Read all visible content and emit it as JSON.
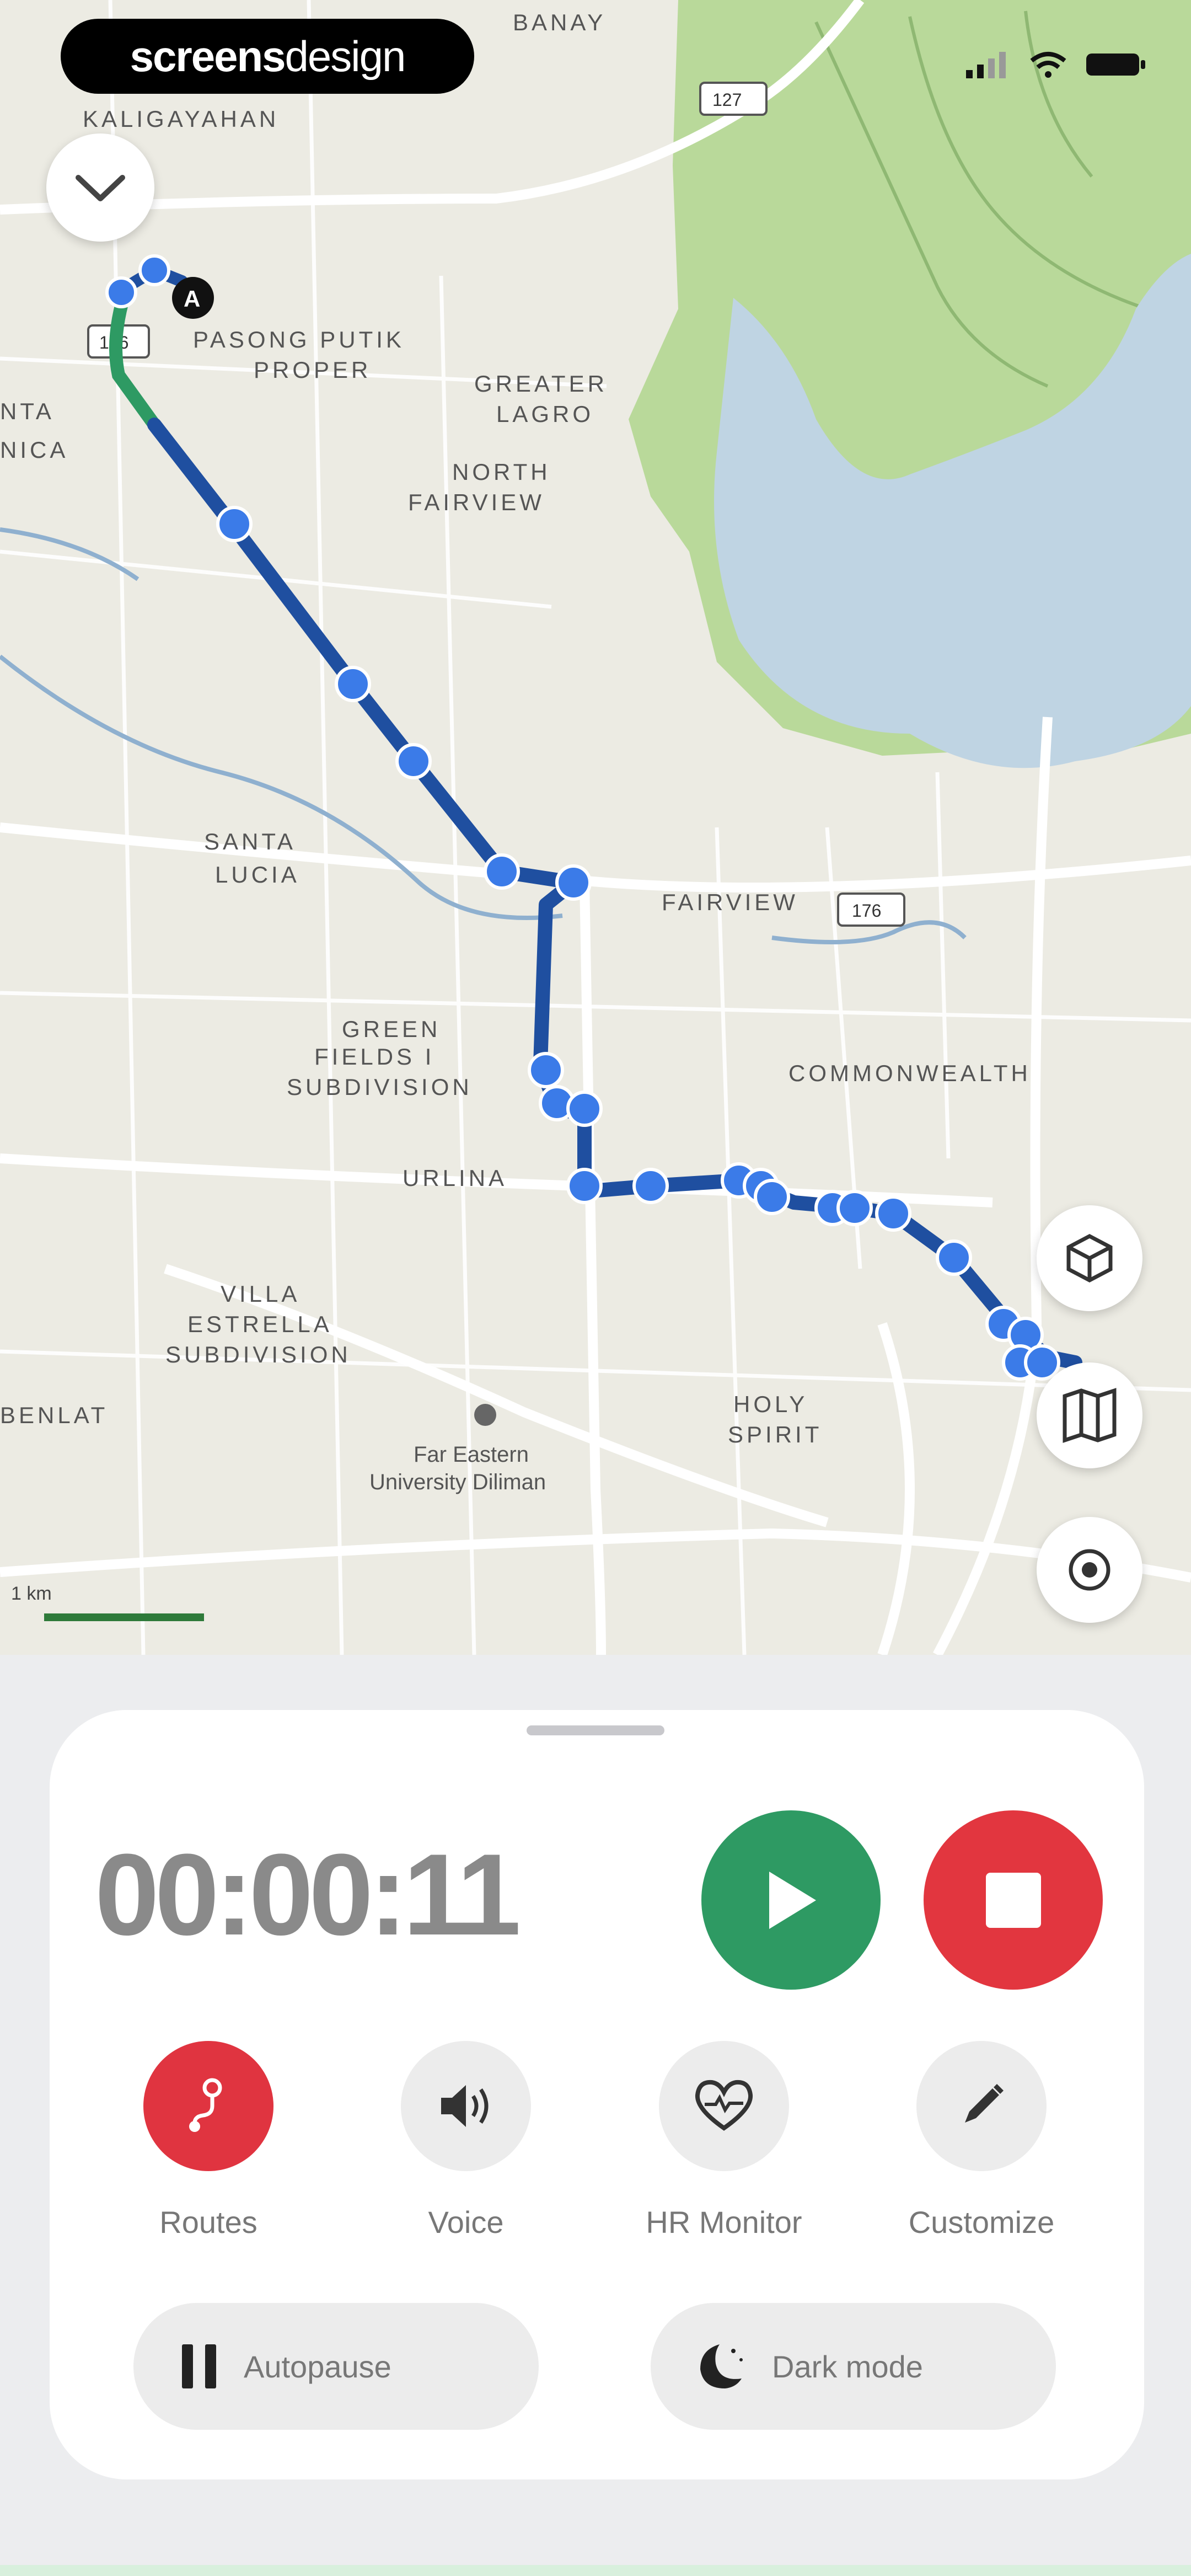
{
  "watermark": {
    "bold": "screens",
    "light": "design"
  },
  "map": {
    "places": [
      "KALIGAYAHAN",
      "PASONG PUTIK",
      "PROPER",
      "GREATER",
      "LAGRO",
      "NORTH",
      "FAIRVIEW",
      "SANTA",
      "LUCIA",
      "FAIRVIEW",
      "GREEN",
      "FIELDS I",
      "SUBDIVISION",
      "COMMONWEALTH",
      "URLINA",
      "VILLA",
      "ESTRELLA",
      "SUBDIVISION",
      "HOLY",
      "SPIRIT",
      "Far Eastern",
      "University Diliman",
      "NTA",
      "NICA",
      "BANAY",
      "BENLAT"
    ],
    "road_labels": [
      "127",
      "176",
      "176"
    ],
    "start_marker": "A",
    "scale_label": "1 km"
  },
  "timer": "00:00:11",
  "actions": [
    {
      "label": "Routes",
      "icon": "routes-icon"
    },
    {
      "label": "Voice",
      "icon": "speaker-icon"
    },
    {
      "label": "HR Monitor",
      "icon": "heart-icon"
    },
    {
      "label": "Customize",
      "icon": "pencil-icon"
    }
  ],
  "toggles": [
    {
      "label": "Autopause",
      "icon": "pause-icon"
    },
    {
      "label": "Dark mode",
      "icon": "moon-icon"
    }
  ],
  "colors": {
    "play": "#2e9a63",
    "stop": "#e2363f",
    "routes": "#e03440",
    "route_line": "#1f4fa0",
    "route_dot": "#3b7be8",
    "map_bg": "#ecebe3",
    "park": "#b7d896",
    "water": "#bed3e3"
  }
}
